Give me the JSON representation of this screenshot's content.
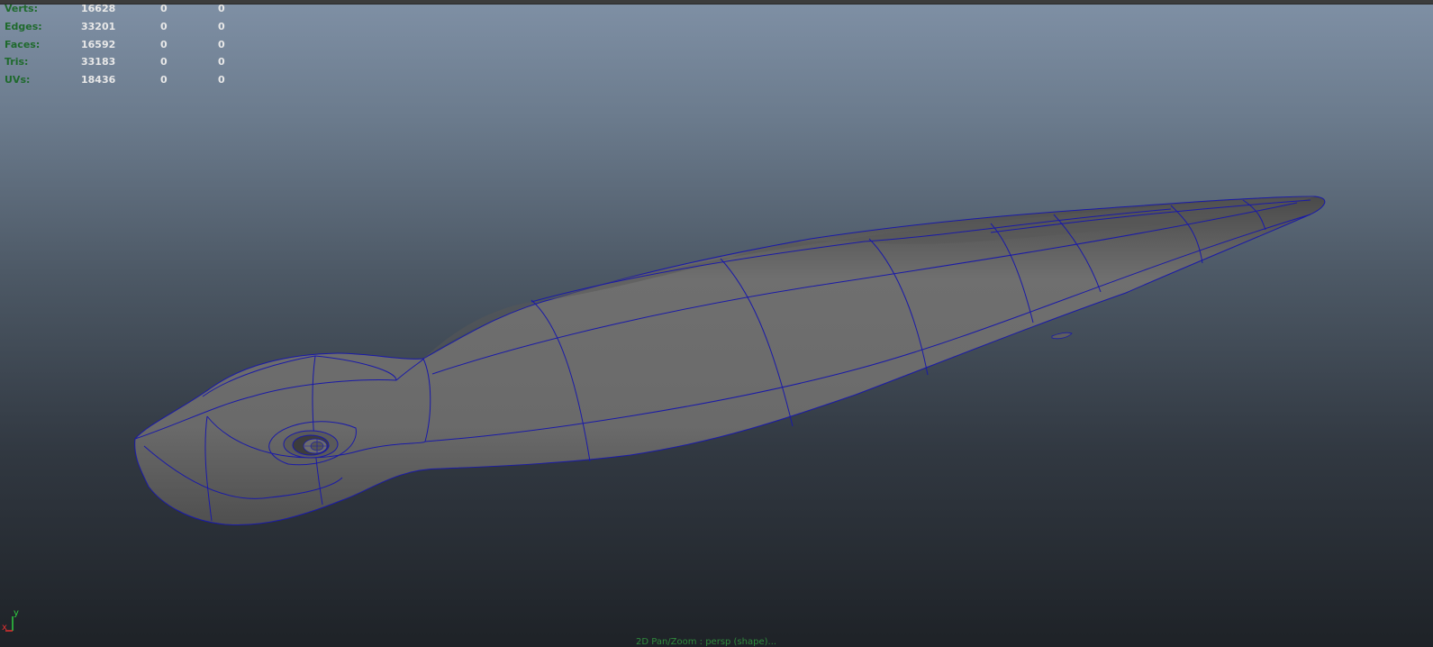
{
  "hud": {
    "rows": [
      {
        "label": "Verts:",
        "total": "16628",
        "sel1": "0",
        "sel2": "0"
      },
      {
        "label": "Edges:",
        "total": "33201",
        "sel1": "0",
        "sel2": "0"
      },
      {
        "label": "Faces:",
        "total": "16592",
        "sel1": "0",
        "sel2": "0"
      },
      {
        "label": "Tris:",
        "total": "33183",
        "sel1": "0",
        "sel2": "0"
      },
      {
        "label": "UVs:",
        "total": "18436",
        "sel1": "0",
        "sel2": "0"
      }
    ]
  },
  "axis": {
    "y_label": "y",
    "x_label": "x"
  },
  "status": {
    "text": "2D Pan/Zoom : persp (shape)..."
  },
  "colors": {
    "hud_label": "#1f6a2d",
    "hud_value": "#e8e8e8",
    "wireframe": "#1a1aa8",
    "mesh_fill": "#6e6e6e"
  },
  "icons": {
    "axis": "axis-gizmo-icon",
    "eye": "model-eye-detail"
  }
}
